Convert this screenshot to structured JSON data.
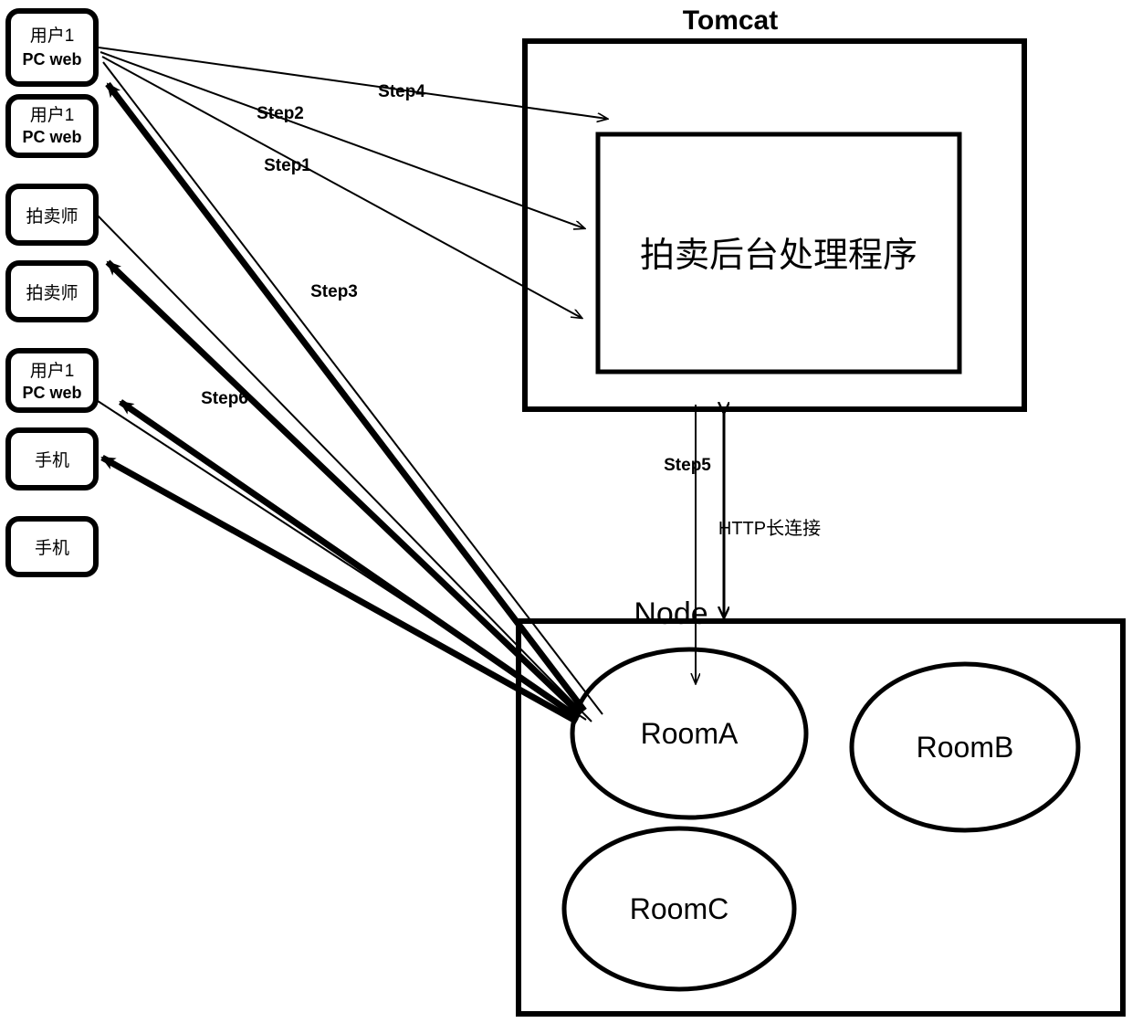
{
  "diagram": {
    "title": "Tomcat",
    "server": {
      "outer_label": "Tomcat",
      "inner_label": "拍卖后台处理程序"
    },
    "node": {
      "label": "Node",
      "rooms": [
        {
          "id": "room-a",
          "label": "RoomA"
        },
        {
          "id": "room-b",
          "label": "RoomB"
        },
        {
          "id": "room-c",
          "label": "RoomC"
        }
      ]
    },
    "clients": [
      {
        "id": "client-user1-pcweb-1",
        "line1": "用户1",
        "line2": "PC web"
      },
      {
        "id": "client-user1-pcweb-2",
        "line1": "用户1",
        "line2": "PC web"
      },
      {
        "id": "client-auctioneer-1",
        "line1": "拍卖师",
        "line2": ""
      },
      {
        "id": "client-auctioneer-2",
        "line1": "拍卖师",
        "line2": ""
      },
      {
        "id": "client-user1-pcweb-3",
        "line1": "用户1",
        "line2": "PC web"
      },
      {
        "id": "client-mobile-1",
        "line1": "手机",
        "line2": ""
      },
      {
        "id": "client-mobile-2",
        "line1": "手机",
        "line2": ""
      }
    ],
    "steps": [
      {
        "id": "step1",
        "label": "Step1"
      },
      {
        "id": "step2",
        "label": "Step2"
      },
      {
        "id": "step3",
        "label": "Step3"
      },
      {
        "id": "step4",
        "label": "Step4"
      },
      {
        "id": "step5",
        "label": "Step5"
      },
      {
        "id": "step6",
        "label": "Step6"
      }
    ],
    "connection": {
      "label": "HTTP长连接"
    },
    "colors": {
      "stroke": "#000000",
      "background": "#ffffff"
    }
  }
}
